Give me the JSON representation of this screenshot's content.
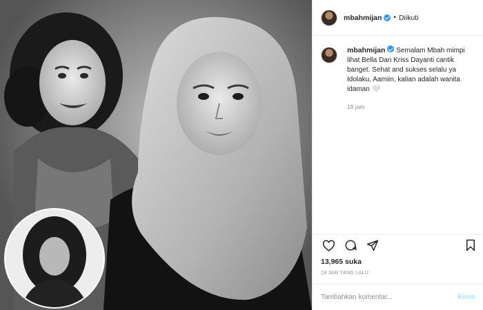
{
  "post": {
    "username": "mbahmijan",
    "follow_status": "Diikuti",
    "caption": "Semalam Mbah mimpi lihat Bella Dan Kriss Dayanti cantik banget. Sehat and sukses selalu ya Idolaku, Aamiin, kalian adalah wanita idaman 🤍",
    "caption_time": "18 jam",
    "likes": "13,965 suka",
    "posted_ago": "18 JAM YANG LALU"
  },
  "comment_box": {
    "placeholder": "Tambahkan komentar...",
    "send_label": "Kirim"
  },
  "icons": [
    "heart-icon",
    "comment-icon",
    "share-icon",
    "bookmark-icon",
    "verified-icon"
  ],
  "colors": {
    "verified": "#3897f0",
    "send_disabled": "#b2dffc",
    "muted": "#8e8e8e"
  }
}
